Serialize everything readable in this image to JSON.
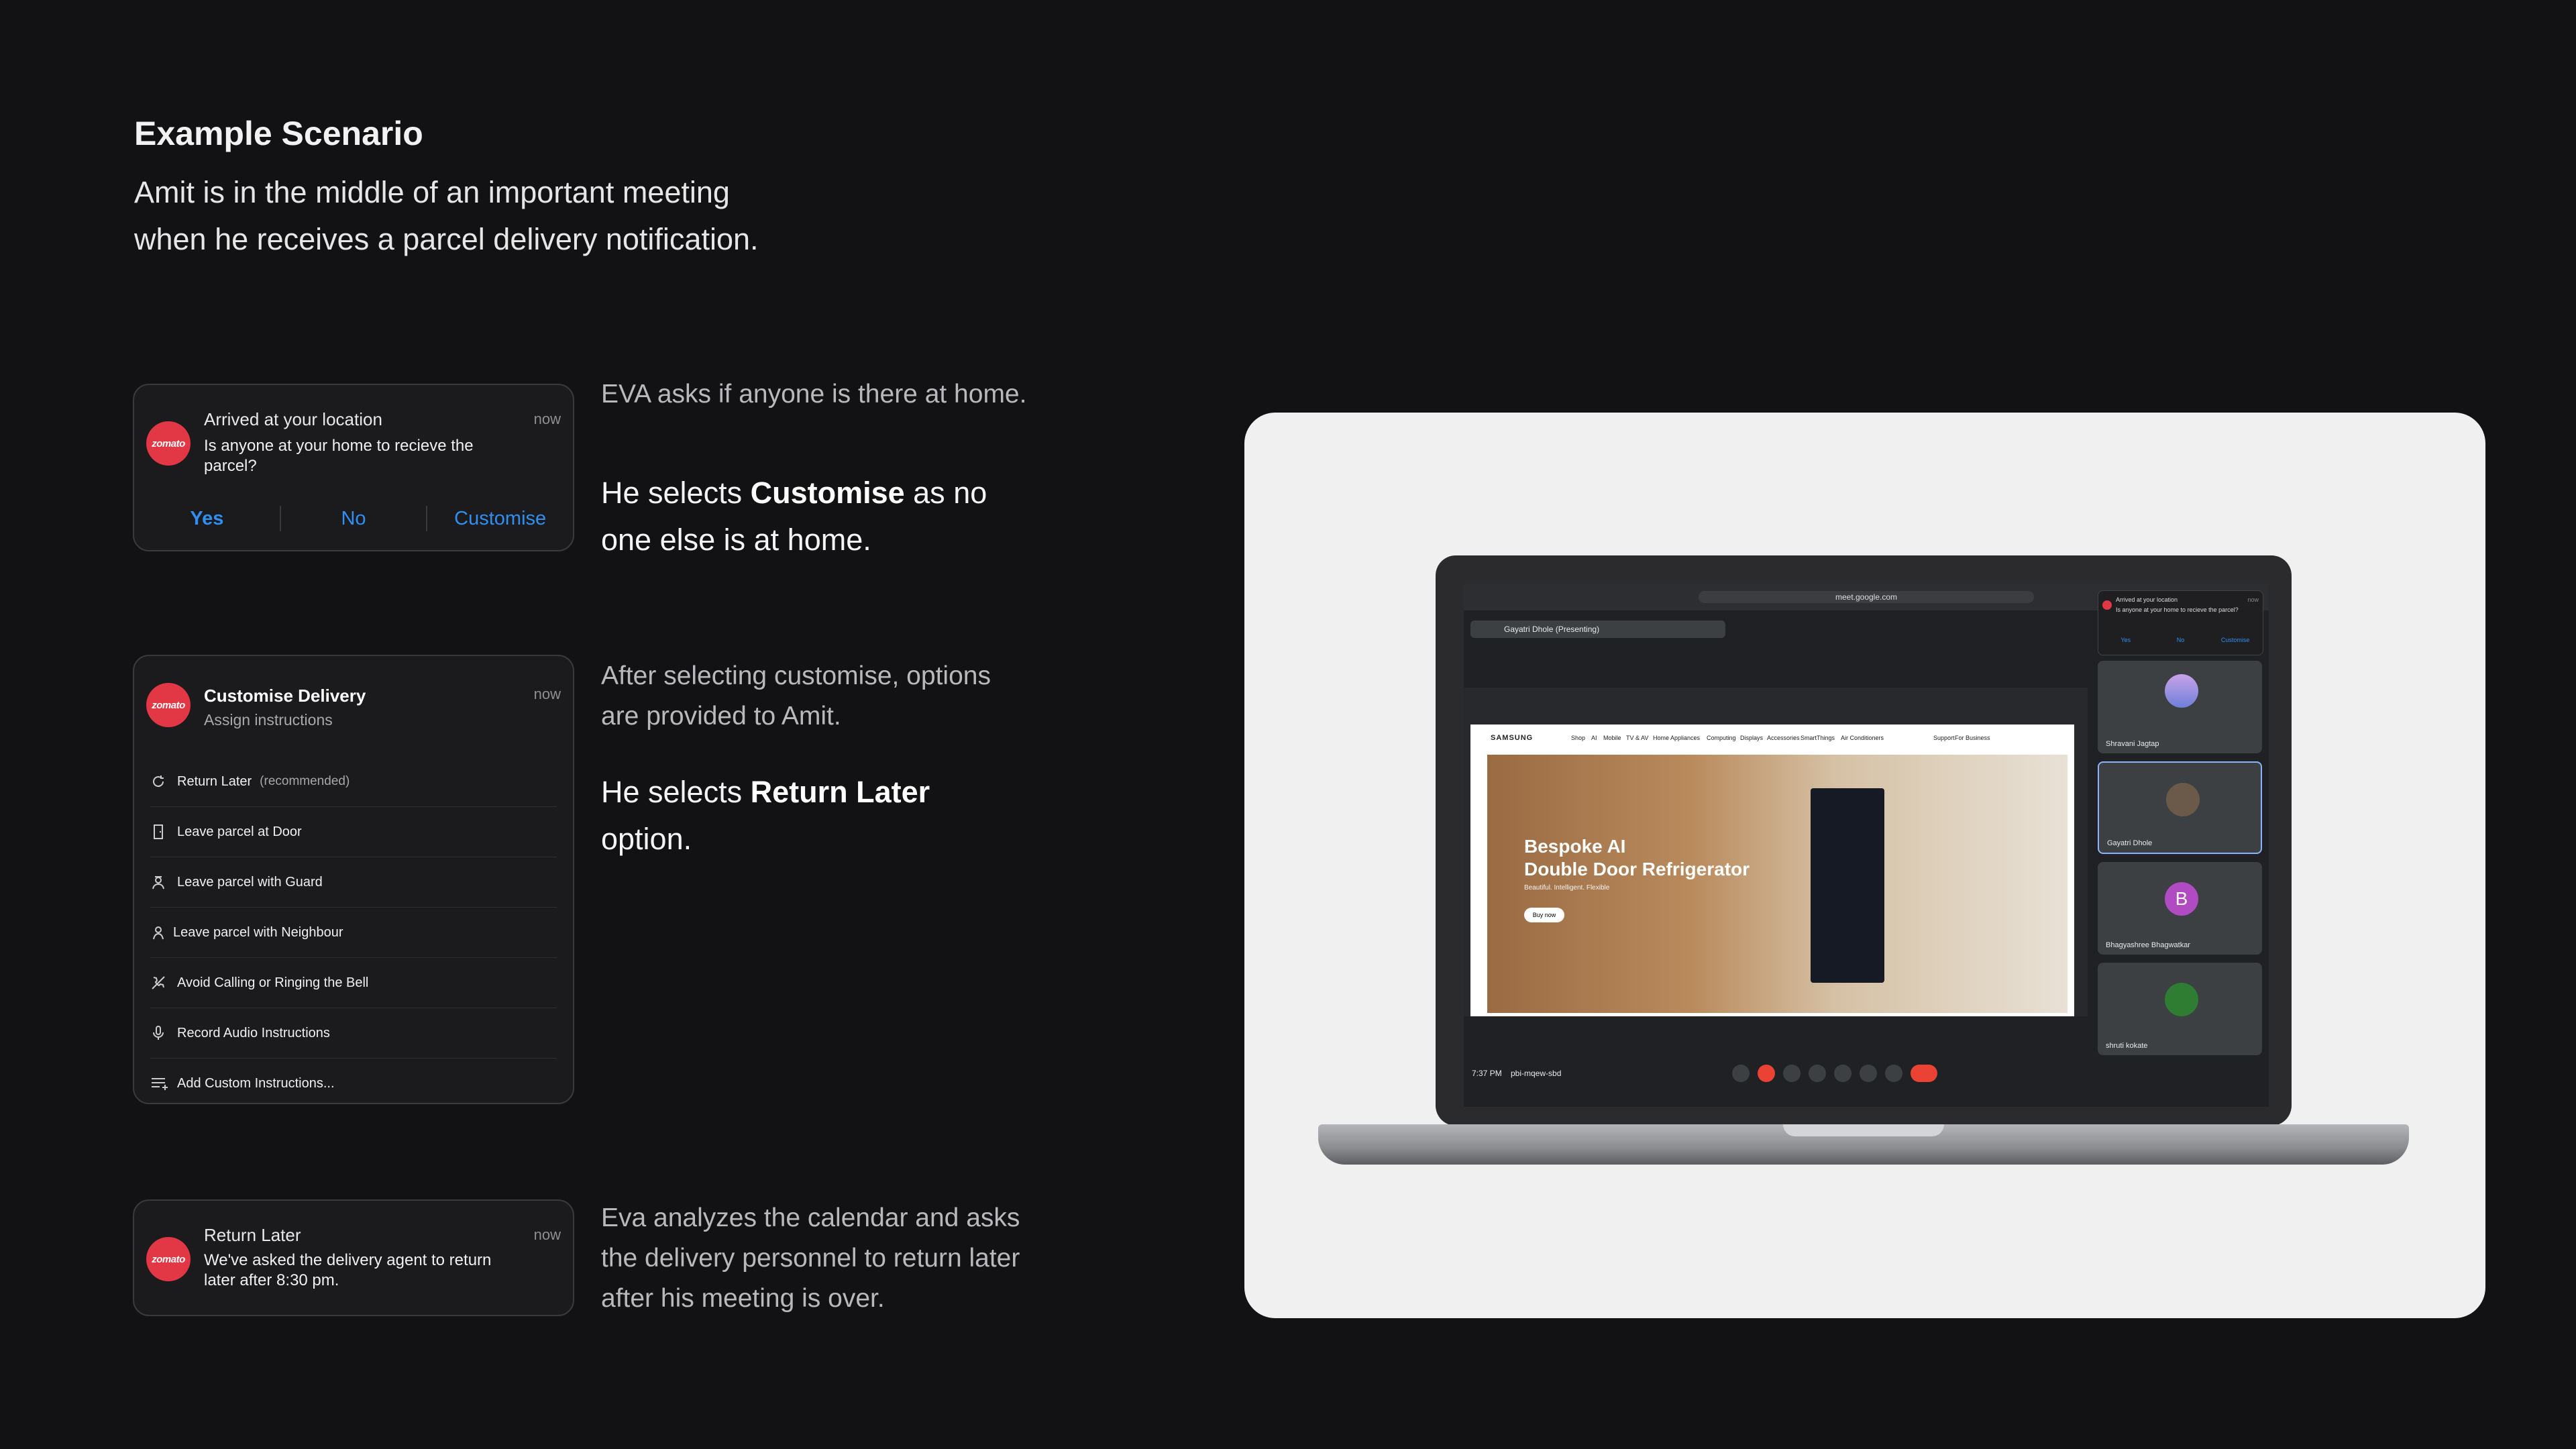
{
  "header": {
    "title": "Example Scenario",
    "subtitle_line1": "Amit is in the middle of an important meeting",
    "subtitle_line2": "when he receives a parcel delivery notification."
  },
  "card1": {
    "logo": "zomato",
    "title": "Arrived at your location",
    "body": "Is anyone at your home to recieve the parcel?",
    "time": "now",
    "actions": [
      "Yes",
      "No",
      "Customise"
    ]
  },
  "card2": {
    "logo": "zomato",
    "title": "Customise Delivery",
    "subtitle": "Assign instructions",
    "time": "now",
    "options": [
      {
        "label": "Return Later",
        "note": "(recommended)",
        "icon": "refresh-icon"
      },
      {
        "label": "Leave parcel at Door",
        "icon": "door-icon"
      },
      {
        "label": "Leave parcel with Guard",
        "icon": "guard-icon"
      },
      {
        "label": "Leave parcel with Neighbour",
        "icon": "neighbour-icon"
      },
      {
        "label": "Avoid Calling or Ringing the Bell",
        "icon": "no-call-icon"
      },
      {
        "label": "Record Audio Instructions",
        "icon": "mic-icon"
      },
      {
        "label": "Add Custom Instructions...",
        "icon": "add-list-icon"
      }
    ]
  },
  "card3": {
    "logo": "zomato",
    "title": "Return Later",
    "body": "We've asked the delivery agent to return later after 8:30 pm.",
    "time": "now"
  },
  "descriptions": {
    "step1": "EVA asks if anyone is there at home.",
    "step1b_pre": "He selects ",
    "step1b_bold": "Customise",
    "step1b_post": " as no one else is at home.",
    "step2_line1": "After selecting customise, options",
    "step2_line2": "are provided to Amit.",
    "step2b_pre": "He selects ",
    "step2b_bold": "Return Later",
    "step2b_post": " option.",
    "step3_line1": "Eva analyzes the calendar and asks",
    "step3_line2": "the delivery personnel to return later",
    "step3_line3": "after his meeting is over."
  },
  "laptop": {
    "url": "meet.google.com",
    "presenting": "Gayatri Dhole (Presenting)",
    "site_brand": "SAMSUNG",
    "site_nav": [
      "Shop",
      "AI",
      "Mobile",
      "TV & AV",
      "Home Appliances",
      "Computing",
      "Displays",
      "Accessories",
      "SmartThings",
      "Air Conditioners"
    ],
    "site_nav_right": [
      "Support",
      "For Business"
    ],
    "hero_title_line1": "Bespoke AI",
    "hero_title_line2": "Double Door Refrigerator",
    "hero_sub": "Beautiful. Intelligent. Flexible",
    "hero_button": "Buy now",
    "participants": [
      "Shravani Jagtap",
      "Gayatri Dhole",
      "Bhagyashree Bhagwatkar",
      "shruti kokate"
    ],
    "participant_initial": "B",
    "time": "7:37 PM",
    "meeting_code": "pbi-mqew-sbd",
    "mini_notif_title": "Arrived at your location",
    "mini_notif_body": "Is anyone at your home to recieve the parcel?",
    "mini_notif_time": "now",
    "mini_notif_actions": [
      "Yes",
      "No",
      "Customise"
    ]
  },
  "colors": {
    "background": "#121214",
    "card": "#1b1b1d",
    "accent_blue": "#2f8ff4",
    "zomato_red": "#e23744",
    "panel": "#f0f0f0"
  }
}
